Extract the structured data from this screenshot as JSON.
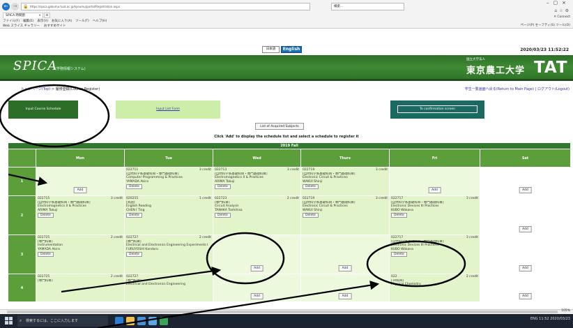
{
  "browser": {
    "url": "https://spica.gakumu.tuat.ac.jp/kyoumu/portal/Registration.aspx",
    "search": "検索...",
    "tab_title": "SPICA 時間割",
    "menu": [
      "ファイル(F)",
      "編集(E)",
      "表示(V)",
      "お気に入り(A)",
      "ツール(T)",
      "ヘルプ(H)"
    ],
    "favorites": [
      "Web スライス ギャラリー",
      "おすすめサイト"
    ],
    "right_tools": "ページ(P) セーフティ(S) ツール(O)",
    "connect": "Connect"
  },
  "lang": {
    "jp": "日本語",
    "en": "English"
  },
  "datetime": "2020/03/23 11:52:22",
  "header": {
    "logo": "SPICA",
    "logo_sub": "(学務情報システム)",
    "univ_small": "国立大学法人",
    "univ": "東京農工大学",
    "tat": "TAT"
  },
  "breadcrumb": {
    "link": "トップページ(Top)",
    "sep": " > ",
    "current": "履修登録(Course Register)"
  },
  "toplinks": "学生一覧画面へ戻る(Return to Main Page) | ログアウト(Logout)",
  "steps": {
    "s1": "Input Course Schedule",
    "s2": "Input List Form",
    "s3": "To confirmation screen"
  },
  "acquired_btn": "List of Acquired Subjects",
  "instruction": "Click 'Add' to display the schedule list and select a schedule to register it",
  "term": "2019 Fall",
  "days": [
    "Mon",
    "Tue",
    "Wed",
    "Thurs",
    "Fri",
    "Sat"
  ],
  "periods": [
    "1",
    "2",
    "3",
    "4"
  ],
  "labels": {
    "add": "Add",
    "delete": "Delete"
  },
  "grid": [
    [
      {
        "type": "empty"
      },
      {
        "code": "022711",
        "credit": "3 credit",
        "cat": "[自然科学系基礎科目・専門基礎科目]",
        "title": "Computer Programming & Practices",
        "teacher": "YAMADA Akira"
      },
      {
        "code": "022713",
        "credit": "3 credit",
        "cat": "[自然科学系基礎科目・専門基礎科目]",
        "title": "Electromagnetics II & Practices",
        "teacher": "ARIMA Takuji"
      },
      {
        "code": "022719",
        "credit": "3 credit",
        "cat": "[自然科学系基礎科目・専門基礎科目]",
        "title": "Electronic Circuit & Practices",
        "teacher": "WAKUI Shinji"
      },
      {
        "type": "empty"
      },
      {
        "type": "white"
      }
    ],
    [
      {
        "code": "022715",
        "credit": "3 credit",
        "cat": "[自然科学系基礎科目・専門基礎科目]",
        "title": "Electromagnetics II & Practices",
        "teacher": "ARIMA Takuji"
      },
      {
        "code": "020255",
        "credit": "1 credit",
        "cat": "[英語]",
        "title": "English Reading",
        "teacher": "CHEN I Ting"
      },
      {
        "code": "022723",
        "credit": "2 credit",
        "cat": "[専門科目]",
        "title": "Circuit Analysis",
        "teacher": "TANAKA Toshihisa"
      },
      {
        "code": "022719",
        "credit": "3 credit",
        "cat": "[自然科学系基礎科目・専門基礎科目]",
        "title": "Electronic Circuit & Practices",
        "teacher": "WAKUI Shinji"
      },
      {
        "code": "022717",
        "credit": "3 credit",
        "cat": "[自然科学系基礎科目・専門基礎科目]",
        "title": "Electronic Devices III Practices",
        "teacher": "KUBO Wakana"
      },
      {
        "type": "white"
      }
    ],
    [
      {
        "code": "022725",
        "credit": "2 credit",
        "cat": "[専門科目]",
        "title": "Instrumentation",
        "teacher": "YAMADA Akira"
      },
      {
        "code": "022727",
        "credit": "2 credit",
        "cat": "[専門科目]",
        "title": "Electrical and Electronics Engineering Experiments I",
        "teacher": "FURUYOSHI Kandaru"
      },
      {
        "type": "empty"
      },
      {
        "type": "empty"
      },
      {
        "code": "022717",
        "credit": "3 credit",
        "cat": "[自然科学系基礎科目・専門基礎科目]",
        "title": "Electronic Devices III Practices",
        "teacher": "KUBO Wakana"
      },
      {
        "type": "white"
      }
    ],
    [
      {
        "code": "022725",
        "credit": "2 credit",
        "cat": "[専門科目]",
        "title": "",
        "teacher": ""
      },
      {
        "code": "022727",
        "credit": "",
        "cat": "[専門科目]",
        "title": "Electrical and Electronics Engineering",
        "teacher": ""
      },
      {
        "type": "empty"
      },
      {
        "type": "empty"
      },
      {
        "code": "022",
        "credit": "2 credit",
        "cat": "[TA科目]",
        "title": "Physical Chemistry",
        "teacher": ""
      },
      {
        "type": "white"
      }
    ]
  ],
  "taskbar": {
    "search": "検索するには、ここに入力します",
    "tray": "ENG  11:52  2020/03/23"
  },
  "zoom": "105%",
  "colors": {
    "banner": "#3f8a33",
    "step_active": "#2c6e27",
    "cell": "#e2f4c9",
    "confirm": "#1a6a62"
  }
}
